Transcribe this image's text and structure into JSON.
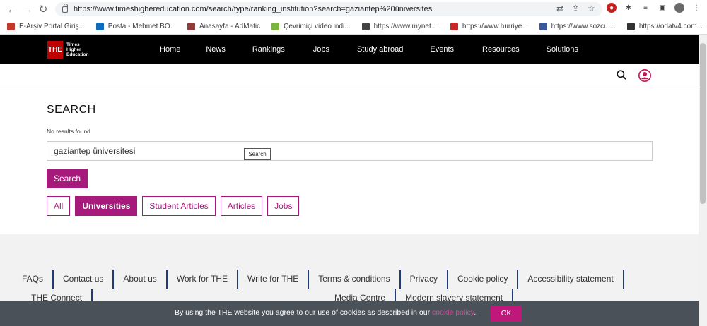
{
  "browser": {
    "url": "https://www.timeshighereducation.com/search/type/ranking_institution?search=gaziantep%20üniversitesi",
    "bookmarks": [
      {
        "label": "E-Arşiv Portal Giriş...",
        "color": "#c0392b"
      },
      {
        "label": "Posta - Mehmet BO...",
        "color": "#0f6cbd"
      },
      {
        "label": "Anasayfa - AdMatic",
        "color": "#8e3b3b"
      },
      {
        "label": "Çevrimiçi video indi...",
        "color": "#7cb342"
      },
      {
        "label": "https://www.mynet....",
        "color": "#444444"
      },
      {
        "label": "https://www.hurriye...",
        "color": "#c62828"
      },
      {
        "label": "https://www.sozcu....",
        "color": "#3b5998"
      },
      {
        "label": "https://odatv4.com...",
        "color": "#333333"
      }
    ]
  },
  "header": {
    "logo_mark": "THE",
    "logo_lines": [
      "Times",
      "Higher",
      "Education"
    ],
    "nav": [
      "Home",
      "News",
      "Rankings",
      "Jobs",
      "Study abroad",
      "Events",
      "Resources",
      "Solutions"
    ]
  },
  "main": {
    "title": "SEARCH",
    "no_results": "No results found",
    "search_value": "gaziantep üniversitesi",
    "tooltip": "Search",
    "search_button": "Search",
    "filters": [
      {
        "label": "All",
        "active": false
      },
      {
        "label": "Universities",
        "active": true
      },
      {
        "label": "Student Articles",
        "active": false
      },
      {
        "label": "Articles",
        "active": false
      },
      {
        "label": "Jobs",
        "active": false
      }
    ]
  },
  "footer": {
    "links": [
      "FAQs",
      "Contact us",
      "About us",
      "Work for THE",
      "Write for THE",
      "Terms & conditions",
      "Privacy",
      "Cookie policy",
      "Accessibility statement",
      "THE Connect",
      "Media Centre",
      "Modern slavery statement"
    ]
  },
  "cookie": {
    "text": "By using the THE website you agree to our use of cookies as described in our ",
    "link": "cookie policy",
    "text_end": ".",
    "ok": "OK"
  },
  "colors": {
    "accent": "#a51a7a",
    "nav_bg": "#000000",
    "logo_red": "#c00000",
    "cookie_bg": "#4a5159"
  }
}
